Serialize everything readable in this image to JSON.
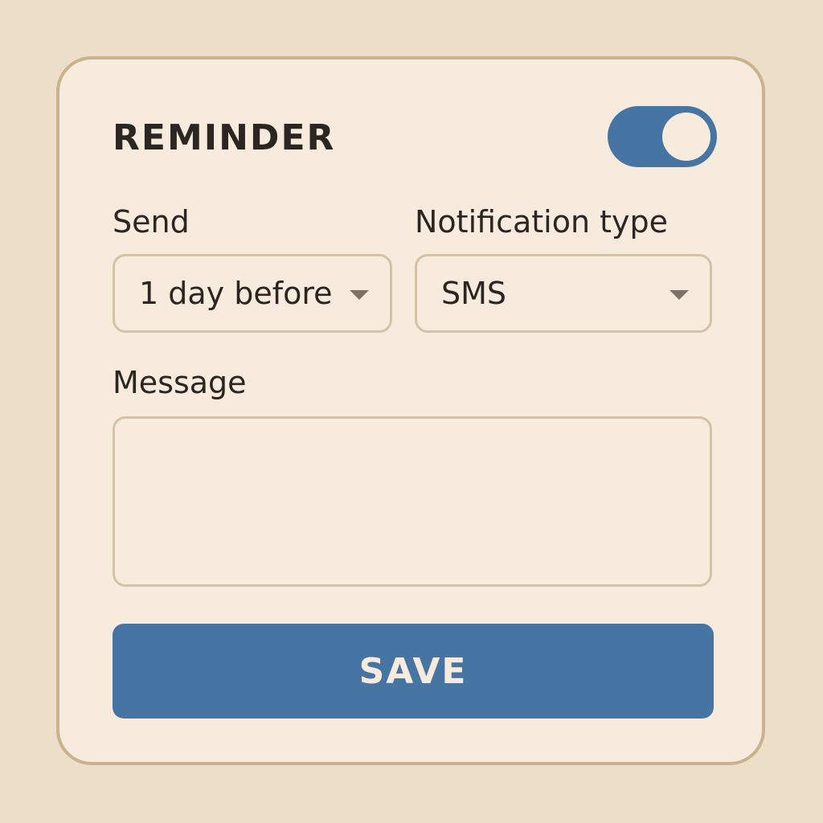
{
  "reminder": {
    "title": "REMINDER",
    "enabled": true,
    "toggle_icon": "toggle-switch-on"
  },
  "send": {
    "label": "Send",
    "selected": "1 day before",
    "caret_icon": "chevron-down-icon"
  },
  "notification_type": {
    "label": "Notification type",
    "selected": "SMS",
    "caret_icon": "chevron-down-icon"
  },
  "message": {
    "label": "Message",
    "value": ""
  },
  "actions": {
    "save_label": "SAVE"
  },
  "colors": {
    "page_background": "#ecdec9",
    "card_background": "#f6ebdc",
    "card_border": "#c9b28c",
    "accent": "#4674a3",
    "text": "#2b2622"
  }
}
